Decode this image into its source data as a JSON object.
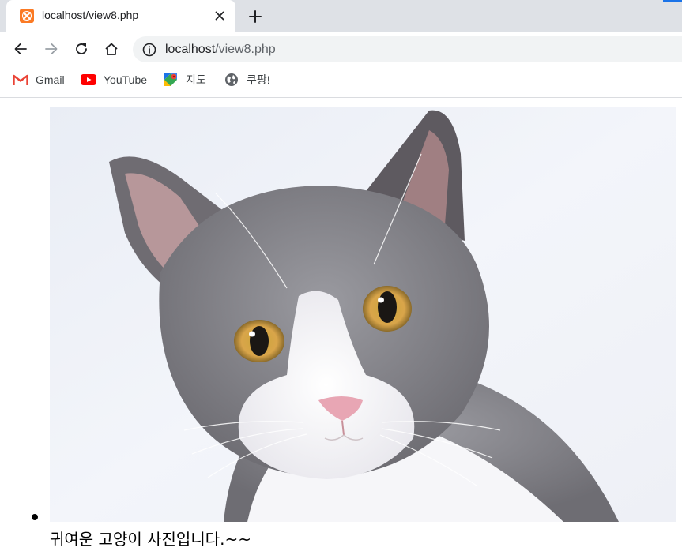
{
  "browser": {
    "tab": {
      "title": "localhost/view8.php",
      "favicon": "xampp-icon"
    },
    "new_tab_icon": "plus-icon",
    "toolbar": {
      "back_icon": "arrow-left-icon",
      "forward_icon": "arrow-right-icon",
      "reload_icon": "reload-icon",
      "home_icon": "home-icon",
      "info_icon": "info-icon",
      "url_host": "localhost",
      "url_path": "/view8.php"
    },
    "bookmarks": [
      {
        "label": "Gmail",
        "icon": "gmail-icon"
      },
      {
        "label": "YouTube",
        "icon": "youtube-icon"
      },
      {
        "label": "지도",
        "icon": "maps-icon"
      },
      {
        "label": "쿠팡!",
        "icon": "globe-icon"
      }
    ]
  },
  "page": {
    "image": "cat-photo",
    "caption": "귀여운 고양이 사진입니다.~~"
  },
  "colors": {
    "tabstrip": "#dee1e6",
    "accent": "#1a73e8",
    "omnibox": "#f1f3f4"
  }
}
